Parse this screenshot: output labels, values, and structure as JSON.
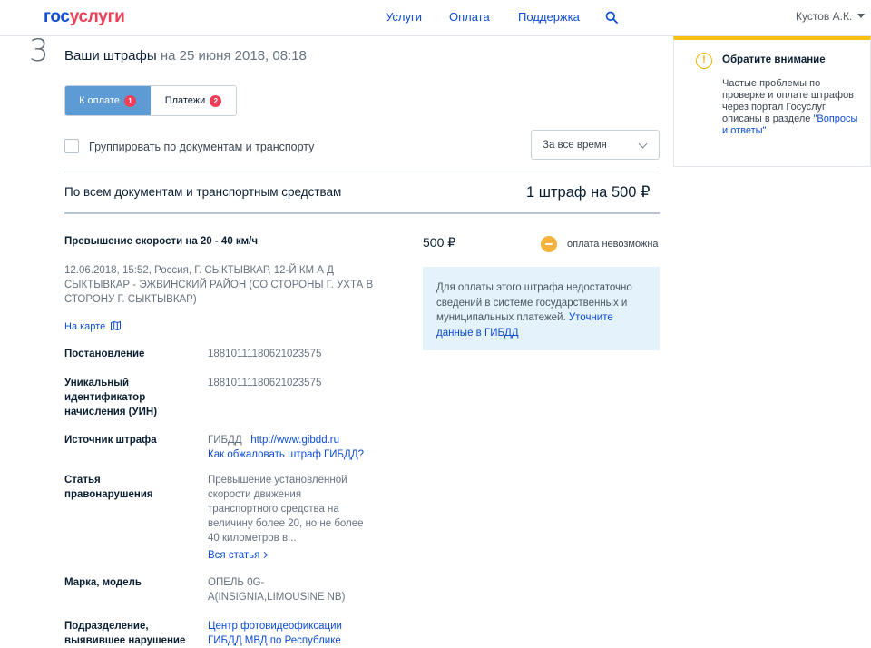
{
  "header": {
    "logo_part1": "гос",
    "logo_part2": "услуги",
    "nav": [
      {
        "label": "Услуги"
      },
      {
        "label": "Оплата"
      },
      {
        "label": "Поддержка"
      }
    ],
    "search_icon": "search-icon",
    "user_name": "Кустов А.К."
  },
  "page": {
    "step_number": "3",
    "title": "Ваши штрафы",
    "title_date": "на 25 июня 2018, 08:18"
  },
  "tabs": [
    {
      "label": "К оплате",
      "count": "1",
      "active": true
    },
    {
      "label": "Платежи",
      "count": "2",
      "active": false
    }
  ],
  "filters": {
    "group_label": "Группировать по документам и транспорту",
    "group_checked": false,
    "period_selected": "За все время"
  },
  "summary": {
    "label": "По всем документам и транспортным средствам",
    "value": "1 штраф на 500 ₽"
  },
  "fine": {
    "title": "Превышение скорости на 20 - 40 км/ч",
    "amount": "500 ₽",
    "status": "оплата невозможна",
    "status_color": "#f5b23d",
    "address": "12.06.2018, 15:52, Россия, Г. СЫКТЫВКАР, 12-Й КМ А Д СЫКТЫВКАР - ЭЖВИНСКИЙ РАЙОН (СО СТОРОНЫ Г. УХТА В СТОРОНУ Г. СЫКТЫВКАР)",
    "map_link": "На карте",
    "notice_text": "Для оплаты этого штрафа недостаточно сведений в системе государственных и муниципальных платежей.",
    "notice_link": "Уточните данные в ГИБДД",
    "details": {
      "decree_label": "Постановление",
      "decree_value": "18810111180621023575",
      "uin_label": "Уникальный идентификатор начисления (УИН)",
      "uin_value": "18810111180621023575",
      "source_label": "Источник штрафа",
      "source_name": "ГИБДД",
      "source_url": "http://www.gibdd.ru",
      "appeal_link": "Как обжаловать штраф ГИБДД?",
      "article_label": "Статья правонарушения",
      "article_value": "Превышение установленной скорости движения транспортного средства на величину более 20, но не более 40 километров в...",
      "article_more": "Вся статья",
      "car_label": "Марка, модель",
      "car_value": "ОПЕЛЬ 0G-A(INSIGNIA,LIMOUSINE NB)",
      "unit_label": "Подразделение, выявившее нарушение",
      "unit_value": "Центр фотовидеофиксации ГИБДД МВД по Республике"
    }
  },
  "sidebar": {
    "title": "Обратите внимание",
    "text": "Частые проблемы по проверке и оплате штрафов через портал Госуслуг описаны в разделе",
    "link": "\"Вопросы и ответы\"",
    "accent_color": "#f5c012"
  }
}
